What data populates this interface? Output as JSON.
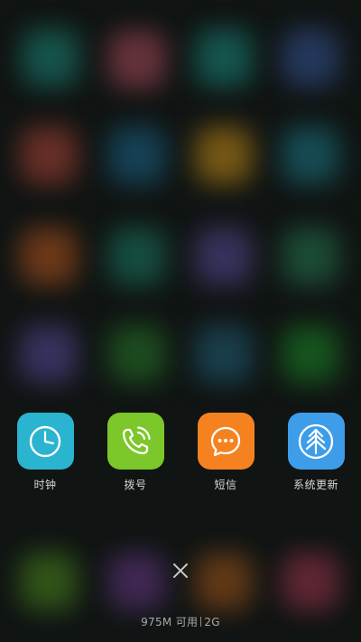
{
  "recent_apps": [
    {
      "label": "时钟",
      "icon": "clock-icon",
      "color": "#2ab4cf"
    },
    {
      "label": "拨号",
      "icon": "phone-icon",
      "color": "#7cc729"
    },
    {
      "label": "短信",
      "icon": "message-icon",
      "color": "#f6821f"
    },
    {
      "label": "系统更新",
      "icon": "system-update-icon",
      "color": "#3d9de8"
    }
  ],
  "close_button": {
    "icon": "close-icon"
  },
  "memory": {
    "available": "975M 可用",
    "total": "2G"
  }
}
